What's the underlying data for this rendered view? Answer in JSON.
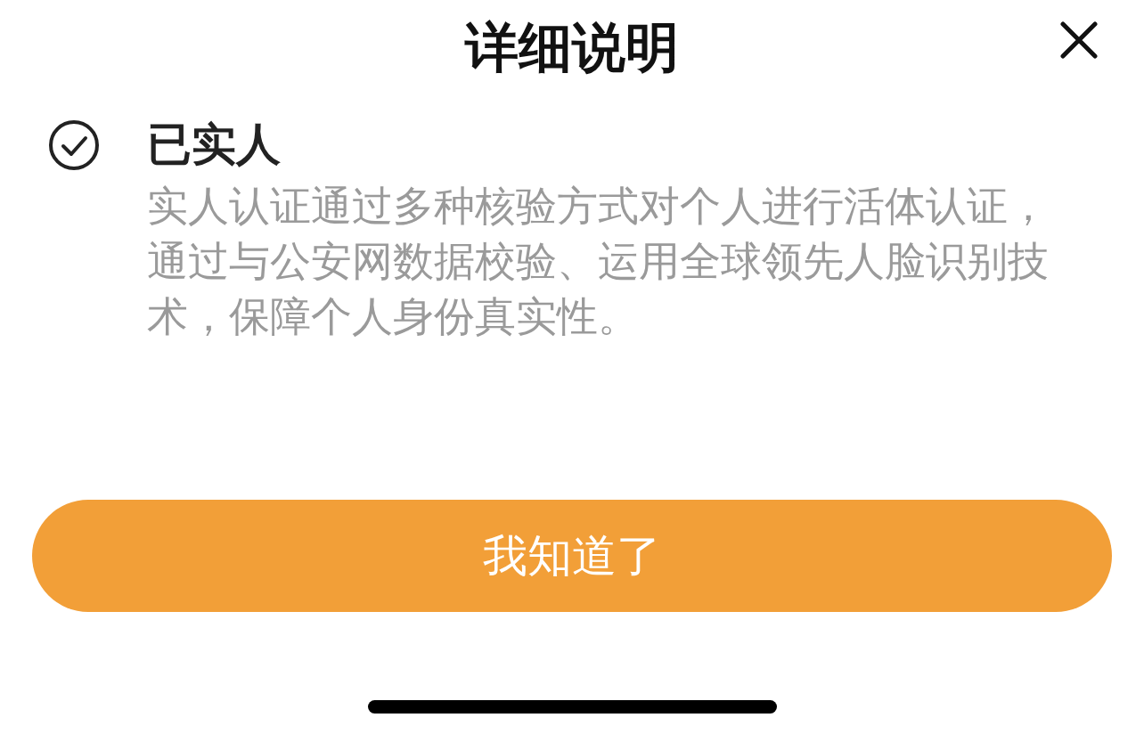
{
  "sheet": {
    "title": "详细说明"
  },
  "items": [
    {
      "checked": true,
      "title": "已实人",
      "description": "实人认证通过多种核验方式对个人进行活体认证，通过与公安网数据校验、运用全球领先人脸识别技术，保障个人身份真实性。"
    }
  ],
  "button": {
    "label": "我知道了"
  }
}
